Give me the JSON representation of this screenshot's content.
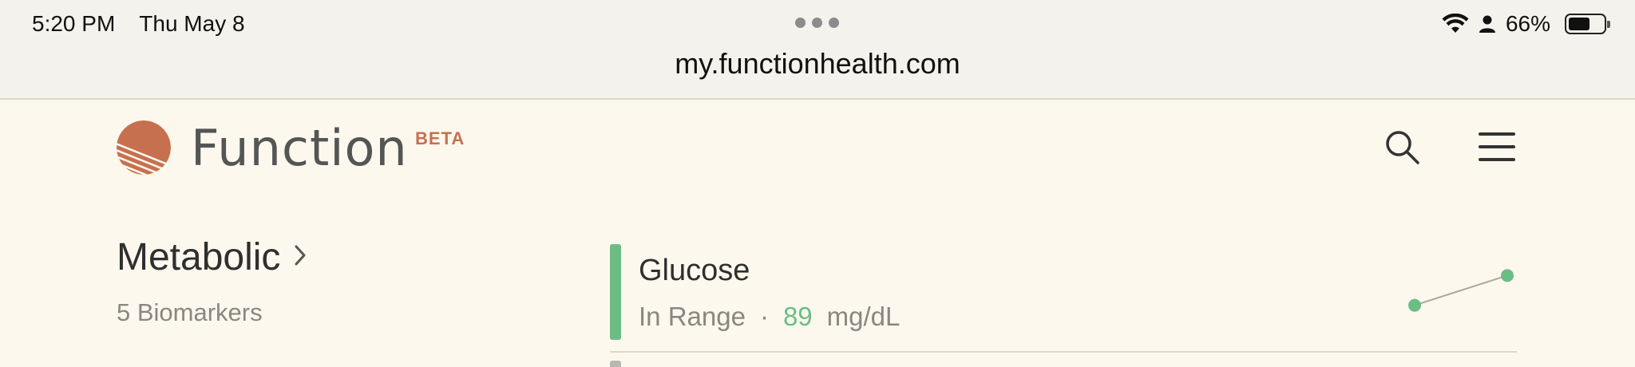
{
  "status_bar": {
    "time": "5:20 PM",
    "date": "Thu May 8",
    "battery": "66%",
    "battery_level": 0.66,
    "icons": [
      "wifi-icon",
      "person-icon",
      "battery-icon"
    ]
  },
  "browser": {
    "url": "my.functionhealth.com"
  },
  "header": {
    "brand": "Function",
    "badge": "BETA",
    "icons": [
      "search-icon",
      "menu-icon"
    ]
  },
  "category": {
    "title": "Metabolic",
    "subtitle": "5 Biomarkers"
  },
  "biomarkers": [
    {
      "name": "Glucose",
      "status": "In Range",
      "separator": "·",
      "value": "89",
      "unit": "mg/dL",
      "history": [
        85,
        89
      ]
    }
  ],
  "colors": {
    "background": "#fcf8ee",
    "brand_accent": "#c7704f",
    "in_range": "#6cbd85",
    "muted_text": "#8a8780"
  }
}
